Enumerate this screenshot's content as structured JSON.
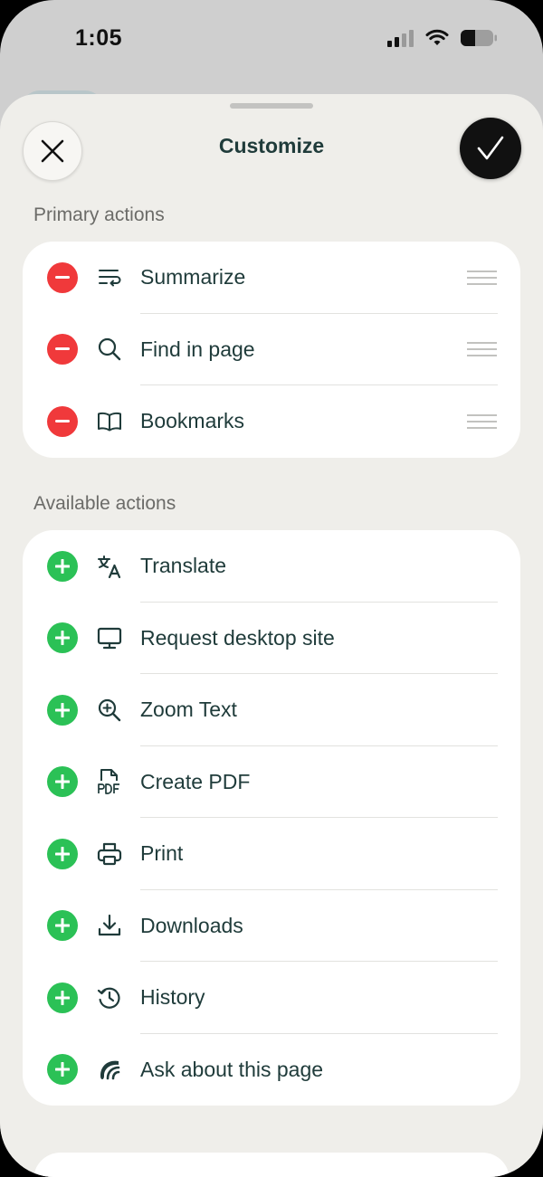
{
  "status_bar": {
    "time": "1:05"
  },
  "header": {
    "title": "Customize"
  },
  "primary": {
    "label": "Primary actions",
    "items": [
      {
        "label": "Summarize",
        "icon": "summarize-icon"
      },
      {
        "label": "Find in page",
        "icon": "search-icon"
      },
      {
        "label": "Bookmarks",
        "icon": "book-icon"
      }
    ]
  },
  "available": {
    "label": "Available actions",
    "items": [
      {
        "label": "Translate",
        "icon": "translate-icon"
      },
      {
        "label": "Request desktop site",
        "icon": "monitor-icon"
      },
      {
        "label": "Zoom Text",
        "icon": "zoom-in-icon"
      },
      {
        "label": "Create PDF",
        "icon": "pdf-icon"
      },
      {
        "label": "Print",
        "icon": "printer-icon"
      },
      {
        "label": "Downloads",
        "icon": "download-icon"
      },
      {
        "label": "History",
        "icon": "history-icon"
      },
      {
        "label": "Ask about this page",
        "icon": "assistant-icon"
      }
    ]
  },
  "colors": {
    "remove": "#f0393b",
    "add": "#2bc156",
    "text": "#1f3b3a",
    "sheet": "#efeeea"
  }
}
